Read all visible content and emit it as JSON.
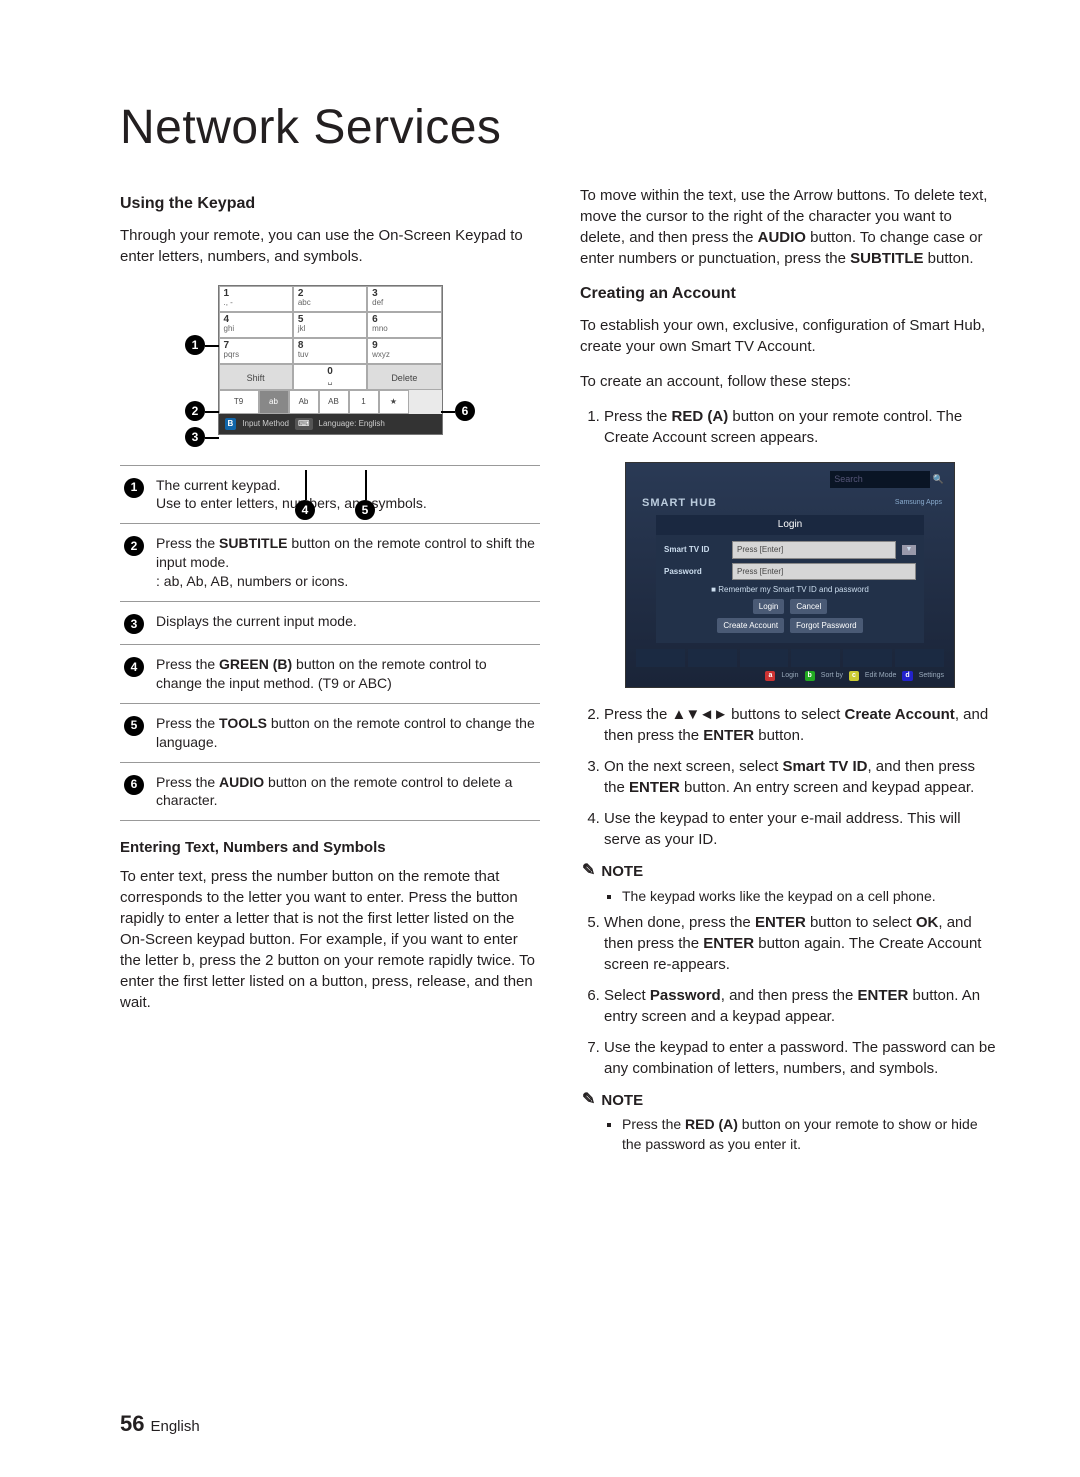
{
  "title": "Network Services",
  "left": {
    "h_keypad": "Using the Keypad",
    "p_keypad": "Through your remote, you can use the On-Screen Keypad to enter letters, numbers, and symbols.",
    "keypad": {
      "r1": [
        {
          "n": "1",
          "s": ""
        },
        {
          "n": "2",
          "s": "abc"
        },
        {
          "n": "3",
          "s": "def"
        }
      ],
      "r2": [
        {
          "n": "4",
          "s": "ghi"
        },
        {
          "n": "5",
          "s": "jkl"
        },
        {
          "n": "6",
          "s": "mno"
        }
      ],
      "r3": [
        {
          "n": "7",
          "s": "pqrs"
        },
        {
          "n": "8",
          "s": "tuv"
        },
        {
          "n": "9",
          "s": "wxyz"
        }
      ],
      "shift": "Shift",
      "zero": "0",
      "zerosub": "␣",
      "delete": "Delete",
      "mode": [
        "T9",
        "ab",
        "Ab",
        "AB",
        "1",
        "★"
      ],
      "footer_b": "B",
      "footer_im": "Input Method",
      "footer_tool": "⌨",
      "footer_lang": "Language: English"
    },
    "legend": [
      {
        "n": "1",
        "t1": "The current keypad.",
        "t2": "Use to enter letters, numbers, and symbols."
      },
      {
        "n": "2",
        "t1": "Press the ",
        "b": "SUBTITLE",
        "t2": " button on the remote control to shift the input mode.",
        "t3": ": ab, Ab, AB, numbers or icons."
      },
      {
        "n": "3",
        "t1": "Displays the current input mode."
      },
      {
        "n": "4",
        "t1": "Press the ",
        "b": "GREEN (B)",
        "t2": " button on the remote control to change the input method. (T9 or ABC)"
      },
      {
        "n": "5",
        "t1": "Press the ",
        "b": "TOOLS",
        "t2": " button on the remote control to change the language."
      },
      {
        "n": "6",
        "t1": "Press the ",
        "b": "AUDIO",
        "t2": " button on the remote control to delete a character."
      }
    ],
    "h_entering": "Entering Text, Numbers and Symbols",
    "p_entering": "To enter text, press the number button on the remote that corresponds to the letter you want to enter. Press the button rapidly to enter a letter that is not the first letter listed on the On-Screen keypad button. For example, if you want to enter the letter b, press the 2 button on your remote rapidly twice. To enter the first letter listed on a button, press, release, and then wait."
  },
  "right": {
    "p_move_pre": "To move within the text, use the Arrow buttons. To delete text, move the cursor to the right of the character you want to delete, and then press the ",
    "b_audio": "AUDIO",
    "p_move_mid": " button. To change case or enter numbers or punctuation, press the ",
    "b_subtitle": "SUBTITLE",
    "p_move_post": " button.",
    "h_create": "Creating an Account",
    "p_create1": "To establish your own, exclusive, configuration of Smart Hub, create your own Smart TV Account.",
    "p_create2": "To create an account, follow these steps:",
    "steps": [
      {
        "pre": "Press the ",
        "b": "RED (A)",
        "post": " button on your remote control. The Create Account screen appears."
      },
      {
        "pre": "Press the ",
        "arrows": "▲▼◄►",
        "mid": " buttons to select ",
        "b": "Create Account",
        "mid2": ", and then press the ",
        "b2": "ENTER",
        "post": " button."
      },
      {
        "pre": "On the next screen, select ",
        "b": "Smart TV ID",
        "mid": ", and then press the ",
        "b2": "ENTER",
        "post": " button. An entry screen and keypad appear."
      },
      {
        "pre": "Use the keypad to enter your e-mail address. This will serve as your ID."
      },
      {
        "pre": "When done, press the ",
        "b": "ENTER",
        "mid": " button to select ",
        "b2": "OK",
        "mid2": ", and then press the ",
        "b3": "ENTER",
        "post": " button again. The Create Account screen re-appears."
      },
      {
        "pre": "Select ",
        "b": "Password",
        "mid": ", and then press the ",
        "b2": "ENTER",
        "post": " button. An entry screen and a keypad appear."
      },
      {
        "pre": "Use the keypad to enter a password. The password can be any combination of letters, numbers, and symbols."
      }
    ],
    "note_label": "NOTE",
    "note1": "The keypad works like the keypad on a cell phone.",
    "note2_pre": "Press the ",
    "note2_b": "RED (A)",
    "note2_post": " button on your remote to show or hide the password as you enter it.",
    "login_fig": {
      "brand": "SMART HUB",
      "search": "Search",
      "apps": "Samsung Apps",
      "panel_title": "Login",
      "id_label": "Smart TV ID",
      "id_ph": "Press [Enter]",
      "pw_label": "Password",
      "pw_ph": "Press [Enter]",
      "remember": "Remember my Smart TV ID and password",
      "b_login": "Login",
      "b_cancel": "Cancel",
      "b_create": "Create Account",
      "b_forgot": "Forgot Password",
      "f_a": "a",
      "f_login": "Login",
      "f_b": "b",
      "f_sort": "Sort by",
      "f_c": "c",
      "f_edit": "Edit Mode",
      "f_d": "d",
      "f_set": "Settings"
    }
  },
  "footer": {
    "num": "56",
    "lang": "English"
  }
}
